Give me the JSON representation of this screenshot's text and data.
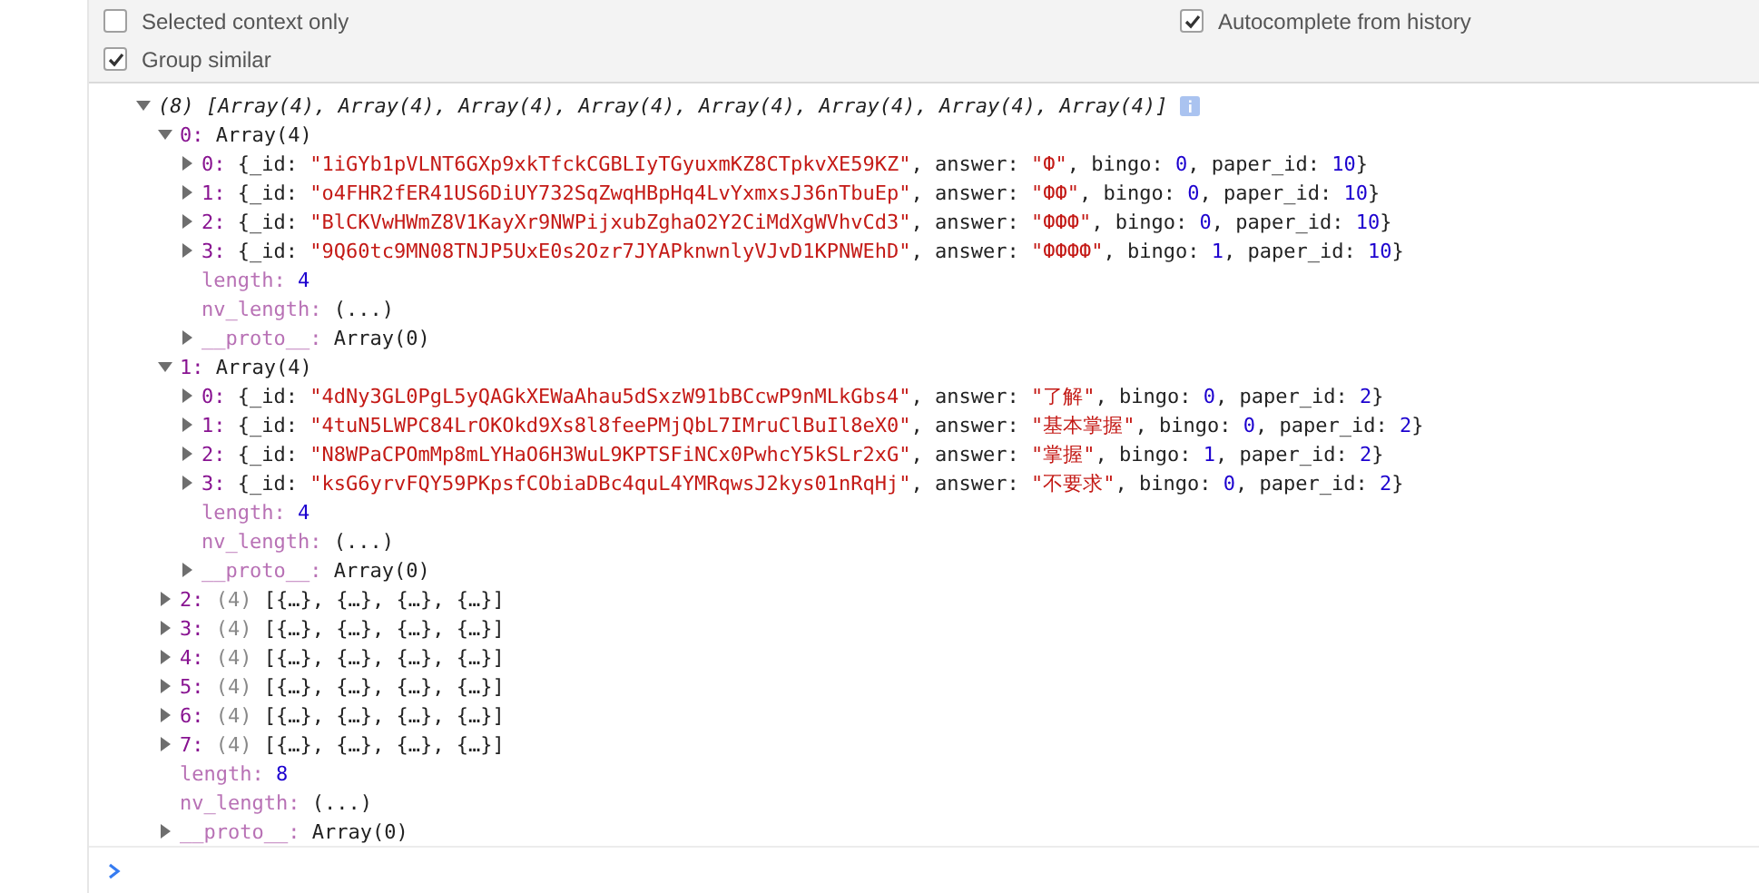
{
  "settings_left": [
    {
      "label": "Selected context only",
      "checked": false
    },
    {
      "label": "Group similar",
      "checked": true
    }
  ],
  "settings_right": [
    {
      "label": "Autocomplete from history",
      "checked": true
    }
  ],
  "console": {
    "summary": {
      "expanded": true,
      "text": "(8) [Array(4), Array(4), Array(4), Array(4), Array(4), Array(4), Array(4), Array(4)]"
    },
    "items": [
      {
        "expanded": true,
        "parts": [
          {
            "text": "0: ",
            "kind": "key"
          },
          {
            "text": "Array(4)",
            "kind": "plain"
          }
        ],
        "children": [
          {
            "expanded": false,
            "parts": [
              {
                "text": "0: ",
                "kind": "key"
              },
              {
                "text": "{_id: ",
                "kind": "plain"
              },
              {
                "text": "\"1iGYb1pVLNT6GXp9xkTfckCGBLIyTGyuxmKZ8CTpkvXE59KZ\"",
                "kind": "string"
              },
              {
                "text": ", answer: ",
                "kind": "plain"
              },
              {
                "text": "\"Ф\"",
                "kind": "string"
              },
              {
                "text": ", bingo: ",
                "kind": "plain"
              },
              {
                "text": "0",
                "kind": "number"
              },
              {
                "text": ", paper_id: ",
                "kind": "plain"
              },
              {
                "text": "10",
                "kind": "number"
              },
              {
                "text": "}",
                "kind": "plain"
              }
            ]
          },
          {
            "expanded": false,
            "parts": [
              {
                "text": "1: ",
                "kind": "key"
              },
              {
                "text": "{_id: ",
                "kind": "plain"
              },
              {
                "text": "\"o4FHR2fER41US6DiUY732SqZwqHBpHq4LvYxmxsJ36nTbuEp\"",
                "kind": "string"
              },
              {
                "text": ", answer: ",
                "kind": "plain"
              },
              {
                "text": "\"ФФ\"",
                "kind": "string"
              },
              {
                "text": ", bingo: ",
                "kind": "plain"
              },
              {
                "text": "0",
                "kind": "number"
              },
              {
                "text": ", paper_id: ",
                "kind": "plain"
              },
              {
                "text": "10",
                "kind": "number"
              },
              {
                "text": "}",
                "kind": "plain"
              }
            ]
          },
          {
            "expanded": false,
            "parts": [
              {
                "text": "2: ",
                "kind": "key"
              },
              {
                "text": "{_id: ",
                "kind": "plain"
              },
              {
                "text": "\"BlCKVwHWmZ8V1KayXr9NWPijxubZghaO2Y2CiMdXgWVhvCd3\"",
                "kind": "string"
              },
              {
                "text": ", answer: ",
                "kind": "plain"
              },
              {
                "text": "\"ФФФ\"",
                "kind": "string"
              },
              {
                "text": ", bingo: ",
                "kind": "plain"
              },
              {
                "text": "0",
                "kind": "number"
              },
              {
                "text": ", paper_id: ",
                "kind": "plain"
              },
              {
                "text": "10",
                "kind": "number"
              },
              {
                "text": "}",
                "kind": "plain"
              }
            ]
          },
          {
            "expanded": false,
            "parts": [
              {
                "text": "3: ",
                "kind": "key"
              },
              {
                "text": "{_id: ",
                "kind": "plain"
              },
              {
                "text": "\"9Q60tc9MN08TNJP5UxE0s2Ozr7JYAPknwnlyVJvD1KPNWEhD\"",
                "kind": "string"
              },
              {
                "text": ", answer: ",
                "kind": "plain"
              },
              {
                "text": "\"ФФФФ\"",
                "kind": "string"
              },
              {
                "text": ", bingo: ",
                "kind": "plain"
              },
              {
                "text": "1",
                "kind": "number"
              },
              {
                "text": ", paper_id: ",
                "kind": "plain"
              },
              {
                "text": "10",
                "kind": "number"
              },
              {
                "text": "}",
                "kind": "plain"
              }
            ]
          },
          {
            "parts": [
              {
                "text": "length: ",
                "kind": "dim"
              },
              {
                "text": "4",
                "kind": "number"
              }
            ]
          },
          {
            "parts": [
              {
                "text": "nv_length: ",
                "kind": "dim"
              },
              {
                "text": "(...)",
                "kind": "plain"
              }
            ]
          },
          {
            "expanded": false,
            "parts": [
              {
                "text": "__proto__: ",
                "kind": "dim"
              },
              {
                "text": "Array(0)",
                "kind": "plain"
              }
            ]
          }
        ]
      },
      {
        "expanded": true,
        "parts": [
          {
            "text": "1: ",
            "kind": "key"
          },
          {
            "text": "Array(4)",
            "kind": "plain"
          }
        ],
        "children": [
          {
            "expanded": false,
            "parts": [
              {
                "text": "0: ",
                "kind": "key"
              },
              {
                "text": "{_id: ",
                "kind": "plain"
              },
              {
                "text": "\"4dNy3GL0PgL5yQAGkXEWaAhau5dSxzW91bBCcwP9nMLkGbs4\"",
                "kind": "string"
              },
              {
                "text": ", answer: ",
                "kind": "plain"
              },
              {
                "text": "\"了解\"",
                "kind": "string"
              },
              {
                "text": ", bingo: ",
                "kind": "plain"
              },
              {
                "text": "0",
                "kind": "number"
              },
              {
                "text": ", paper_id: ",
                "kind": "plain"
              },
              {
                "text": "2",
                "kind": "number"
              },
              {
                "text": "}",
                "kind": "plain"
              }
            ]
          },
          {
            "expanded": false,
            "parts": [
              {
                "text": "1: ",
                "kind": "key"
              },
              {
                "text": "{_id: ",
                "kind": "plain"
              },
              {
                "text": "\"4tuN5LWPC84LrOKOkd9Xs8l8feePMjQbL7IMruClBuIl8eX0\"",
                "kind": "string"
              },
              {
                "text": ", answer: ",
                "kind": "plain"
              },
              {
                "text": "\"基本掌握\"",
                "kind": "string"
              },
              {
                "text": ", bingo: ",
                "kind": "plain"
              },
              {
                "text": "0",
                "kind": "number"
              },
              {
                "text": ", paper_id: ",
                "kind": "plain"
              },
              {
                "text": "2",
                "kind": "number"
              },
              {
                "text": "}",
                "kind": "plain"
              }
            ]
          },
          {
            "expanded": false,
            "parts": [
              {
                "text": "2: ",
                "kind": "key"
              },
              {
                "text": "{_id: ",
                "kind": "plain"
              },
              {
                "text": "\"N8WPaCPOmMp8mLYHaO6H3WuL9KPTSFiNCx0PwhcY5kSLr2xG\"",
                "kind": "string"
              },
              {
                "text": ", answer: ",
                "kind": "plain"
              },
              {
                "text": "\"掌握\"",
                "kind": "string"
              },
              {
                "text": ", bingo: ",
                "kind": "plain"
              },
              {
                "text": "1",
                "kind": "number"
              },
              {
                "text": ", paper_id: ",
                "kind": "plain"
              },
              {
                "text": "2",
                "kind": "number"
              },
              {
                "text": "}",
                "kind": "plain"
              }
            ]
          },
          {
            "expanded": false,
            "parts": [
              {
                "text": "3: ",
                "kind": "key"
              },
              {
                "text": "{_id: ",
                "kind": "plain"
              },
              {
                "text": "\"ksG6yrvFQY59PKpsfCObiaDBc4quL4YMRqwsJ2kys01nRqHj\"",
                "kind": "string"
              },
              {
                "text": ", answer: ",
                "kind": "plain"
              },
              {
                "text": "\"不要求\"",
                "kind": "string"
              },
              {
                "text": ", bingo: ",
                "kind": "plain"
              },
              {
                "text": "0",
                "kind": "number"
              },
              {
                "text": ", paper_id: ",
                "kind": "plain"
              },
              {
                "text": "2",
                "kind": "number"
              },
              {
                "text": "}",
                "kind": "plain"
              }
            ]
          },
          {
            "parts": [
              {
                "text": "length: ",
                "kind": "dim"
              },
              {
                "text": "4",
                "kind": "number"
              }
            ]
          },
          {
            "parts": [
              {
                "text": "nv_length: ",
                "kind": "dim"
              },
              {
                "text": "(...)",
                "kind": "plain"
              }
            ]
          },
          {
            "expanded": false,
            "parts": [
              {
                "text": "__proto__: ",
                "kind": "dim"
              },
              {
                "text": "Array(0)",
                "kind": "plain"
              }
            ]
          }
        ]
      },
      {
        "expanded": false,
        "parts": [
          {
            "text": "2: ",
            "kind": "key"
          },
          {
            "text": "(4) ",
            "kind": "preview"
          },
          {
            "text": "[{…}, {…}, {…}, {…}]",
            "kind": "plain"
          }
        ]
      },
      {
        "expanded": false,
        "parts": [
          {
            "text": "3: ",
            "kind": "key"
          },
          {
            "text": "(4) ",
            "kind": "preview"
          },
          {
            "text": "[{…}, {…}, {…}, {…}]",
            "kind": "plain"
          }
        ]
      },
      {
        "expanded": false,
        "parts": [
          {
            "text": "4: ",
            "kind": "key"
          },
          {
            "text": "(4) ",
            "kind": "preview"
          },
          {
            "text": "[{…}, {…}, {…}, {…}]",
            "kind": "plain"
          }
        ]
      },
      {
        "expanded": false,
        "parts": [
          {
            "text": "5: ",
            "kind": "key"
          },
          {
            "text": "(4) ",
            "kind": "preview"
          },
          {
            "text": "[{…}, {…}, {…}, {…}]",
            "kind": "plain"
          }
        ]
      },
      {
        "expanded": false,
        "parts": [
          {
            "text": "6: ",
            "kind": "key"
          },
          {
            "text": "(4) ",
            "kind": "preview"
          },
          {
            "text": "[{…}, {…}, {…}, {…}]",
            "kind": "plain"
          }
        ]
      },
      {
        "expanded": false,
        "parts": [
          {
            "text": "7: ",
            "kind": "key"
          },
          {
            "text": "(4) ",
            "kind": "preview"
          },
          {
            "text": "[{…}, {…}, {…}, {…}]",
            "kind": "plain"
          }
        ]
      },
      {
        "parts": [
          {
            "text": "length: ",
            "kind": "dim"
          },
          {
            "text": "8",
            "kind": "number"
          }
        ]
      },
      {
        "parts": [
          {
            "text": "nv_length: ",
            "kind": "dim"
          },
          {
            "text": "(...)",
            "kind": "plain"
          }
        ]
      },
      {
        "expanded": false,
        "parts": [
          {
            "text": "__proto__: ",
            "kind": "dim"
          },
          {
            "text": "Array(0)",
            "kind": "plain"
          }
        ]
      }
    ]
  }
}
